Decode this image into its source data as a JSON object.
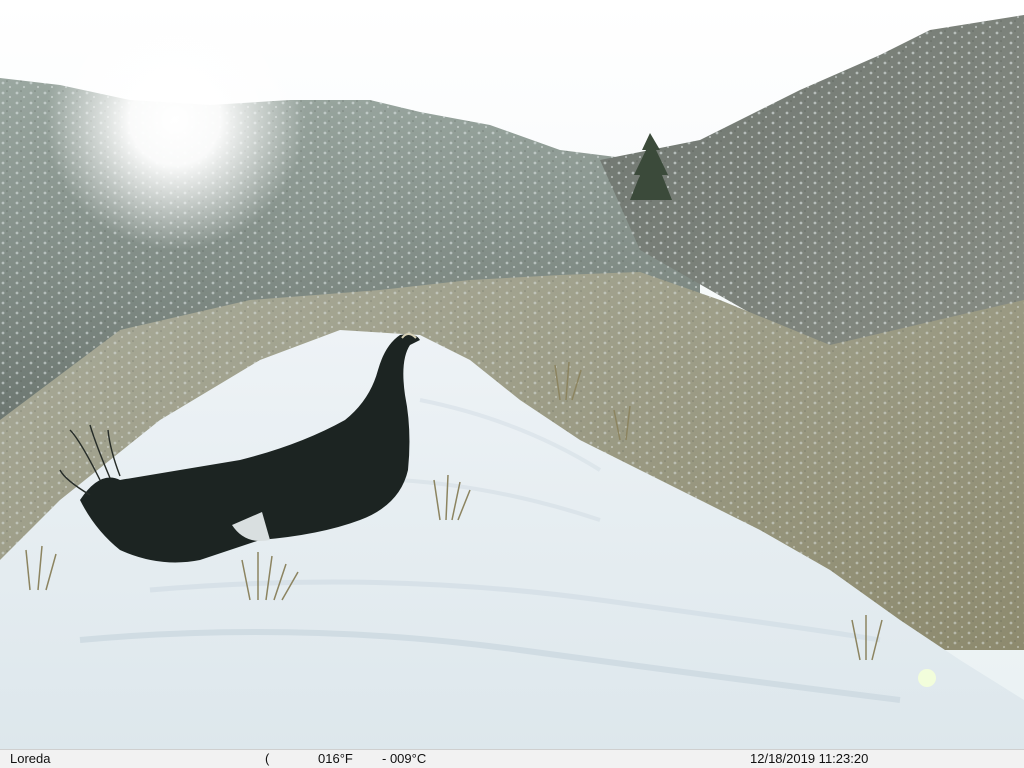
{
  "camera_stamp": {
    "brand": "Loreda",
    "moon_phase_symbol": "(",
    "temp_f": "016°F",
    "temp_c": "- 009°C",
    "datetime": "12/18/2019 11:23:20"
  }
}
